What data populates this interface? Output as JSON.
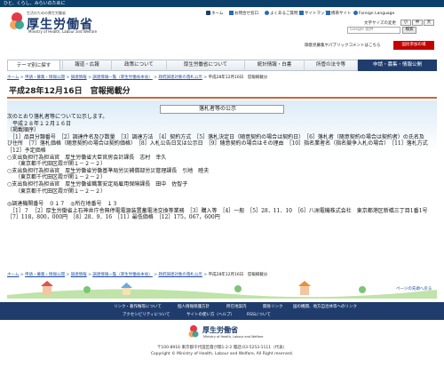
{
  "topbar": {
    "tagline": "ひと、くらし、みらいのために"
  },
  "logo": {
    "small": "生活のための厚生労働省",
    "title": "厚生労働省",
    "english": "Ministry of Health, Labour and Welfare"
  },
  "utility": {
    "home": "ホーム",
    "contact": "お問合せ窓口",
    "faq": "よくあるご質問",
    "sitemap": "サイトマップ",
    "mobile": "携帯サイト",
    "foreign": "Foreign Language",
    "font_size_label": "文字サイズの変更",
    "font_small": "小",
    "font_medium": "中",
    "font_large": "大",
    "search_placeholder": "Google 提供",
    "search_button": "検索",
    "pubcom": "御意見募集やパブリックコメントはこちら",
    "kokumin": "国民参加の場"
  },
  "nav": {
    "items": [
      "テーマ別に探す",
      "報道・広報",
      "政策について",
      "厚生労働省について",
      "統計情報・白書",
      "所管の法令等",
      "申請・募集・情報公開"
    ]
  },
  "breadcrumb": {
    "items": [
      "ホーム",
      "申請・募集・情報公開",
      "調達情報",
      "調達情報一覧（厚生労働省本省）",
      "政府調達対象の落札公示"
    ],
    "current": "平成28年12月16日　官報掲載分"
  },
  "page": {
    "title": "平成28年12月16日　官報掲載分"
  },
  "notice": {
    "heading": "落札者等の公示",
    "lines": [
      "次のとおり落札者等について公示します。",
      "　平成２８年１２月１６日",
      "〔掲載順序〕",
      "　［1］品目分類番号　［2］調達件名及び数量　［3］調達方法　［4］契約方式　［5］落札決定日（随意契約の場合は契約日）　［6］落札者（随意契約の場合は契約者）の氏名及び住所　［7］落札価格（随意契約の場合は契約価格）　［8］入札公告日又は公示日　［9］随意契約の場合はその理由　［10］指名業者名（指名競争入札の場合）　［11］落札方式　［12］予定価格",
      "○支出負担行為担当官　厚生労働省大臣官房会計課長　志村　幸久",
      "　　（東京都千代田区霞が関１－２－２）",
      "○支出負担行為担当官　厚生労働省労働基準局労災補償部労災管理課長　引地　睦夫",
      "　　（東京都千代田区霞が関１－２－２）",
      "○支出負担行為担当官　厚生労働省職業安定局雇用保険課長　田中　佐智子",
      "　　（東京都千代田区霞が関１－２－２）",
      "",
      "◎調達機関番号　０１７　◎所在地番号　１３",
      "　［1］７　［2］厚生労働省上石神井庁舎無停電電源装置蓄電池交換等業務　［3］購入等　［4］一般　［5］28．11．10　［6］八洲電機株式会社　東京都港区新橋三丁目1番1号　［7］118，800，000円　［8］28．9．16　［11］最低価格　［12］175，067，600円"
    ]
  },
  "bottom": {
    "pagetop": "ページの先頭へ戻る"
  },
  "footer": {
    "links": [
      "リンク・著作権等について",
      "個人情報保護方針",
      "所在地案内",
      "アクセシビリティについて",
      "サイトの使い方（ヘルプ）",
      "RSSについて",
      "関係リンク",
      "国の機関、地方自治体等へのリンク"
    ],
    "logo": "厚生労働省",
    "logo_en": "Ministry of Health, Labour and Welfare",
    "address": "〒100-8916 東京都千代田区霞が関1-2-2 電話:03-5253-1111（代表）",
    "copyright": "Copyright © Ministry of Health, Labour and Welfare, All Right reserved."
  },
  "colors": {
    "navy": "#1f3c6d",
    "accent_red": "#c40000",
    "accent_orange": "#cc6633"
  },
  "icons": [
    "house-icon",
    "mail-icon",
    "question-icon",
    "sitemap-icon",
    "mobile-icon",
    "globe-icon",
    "magnifier-icon"
  ]
}
